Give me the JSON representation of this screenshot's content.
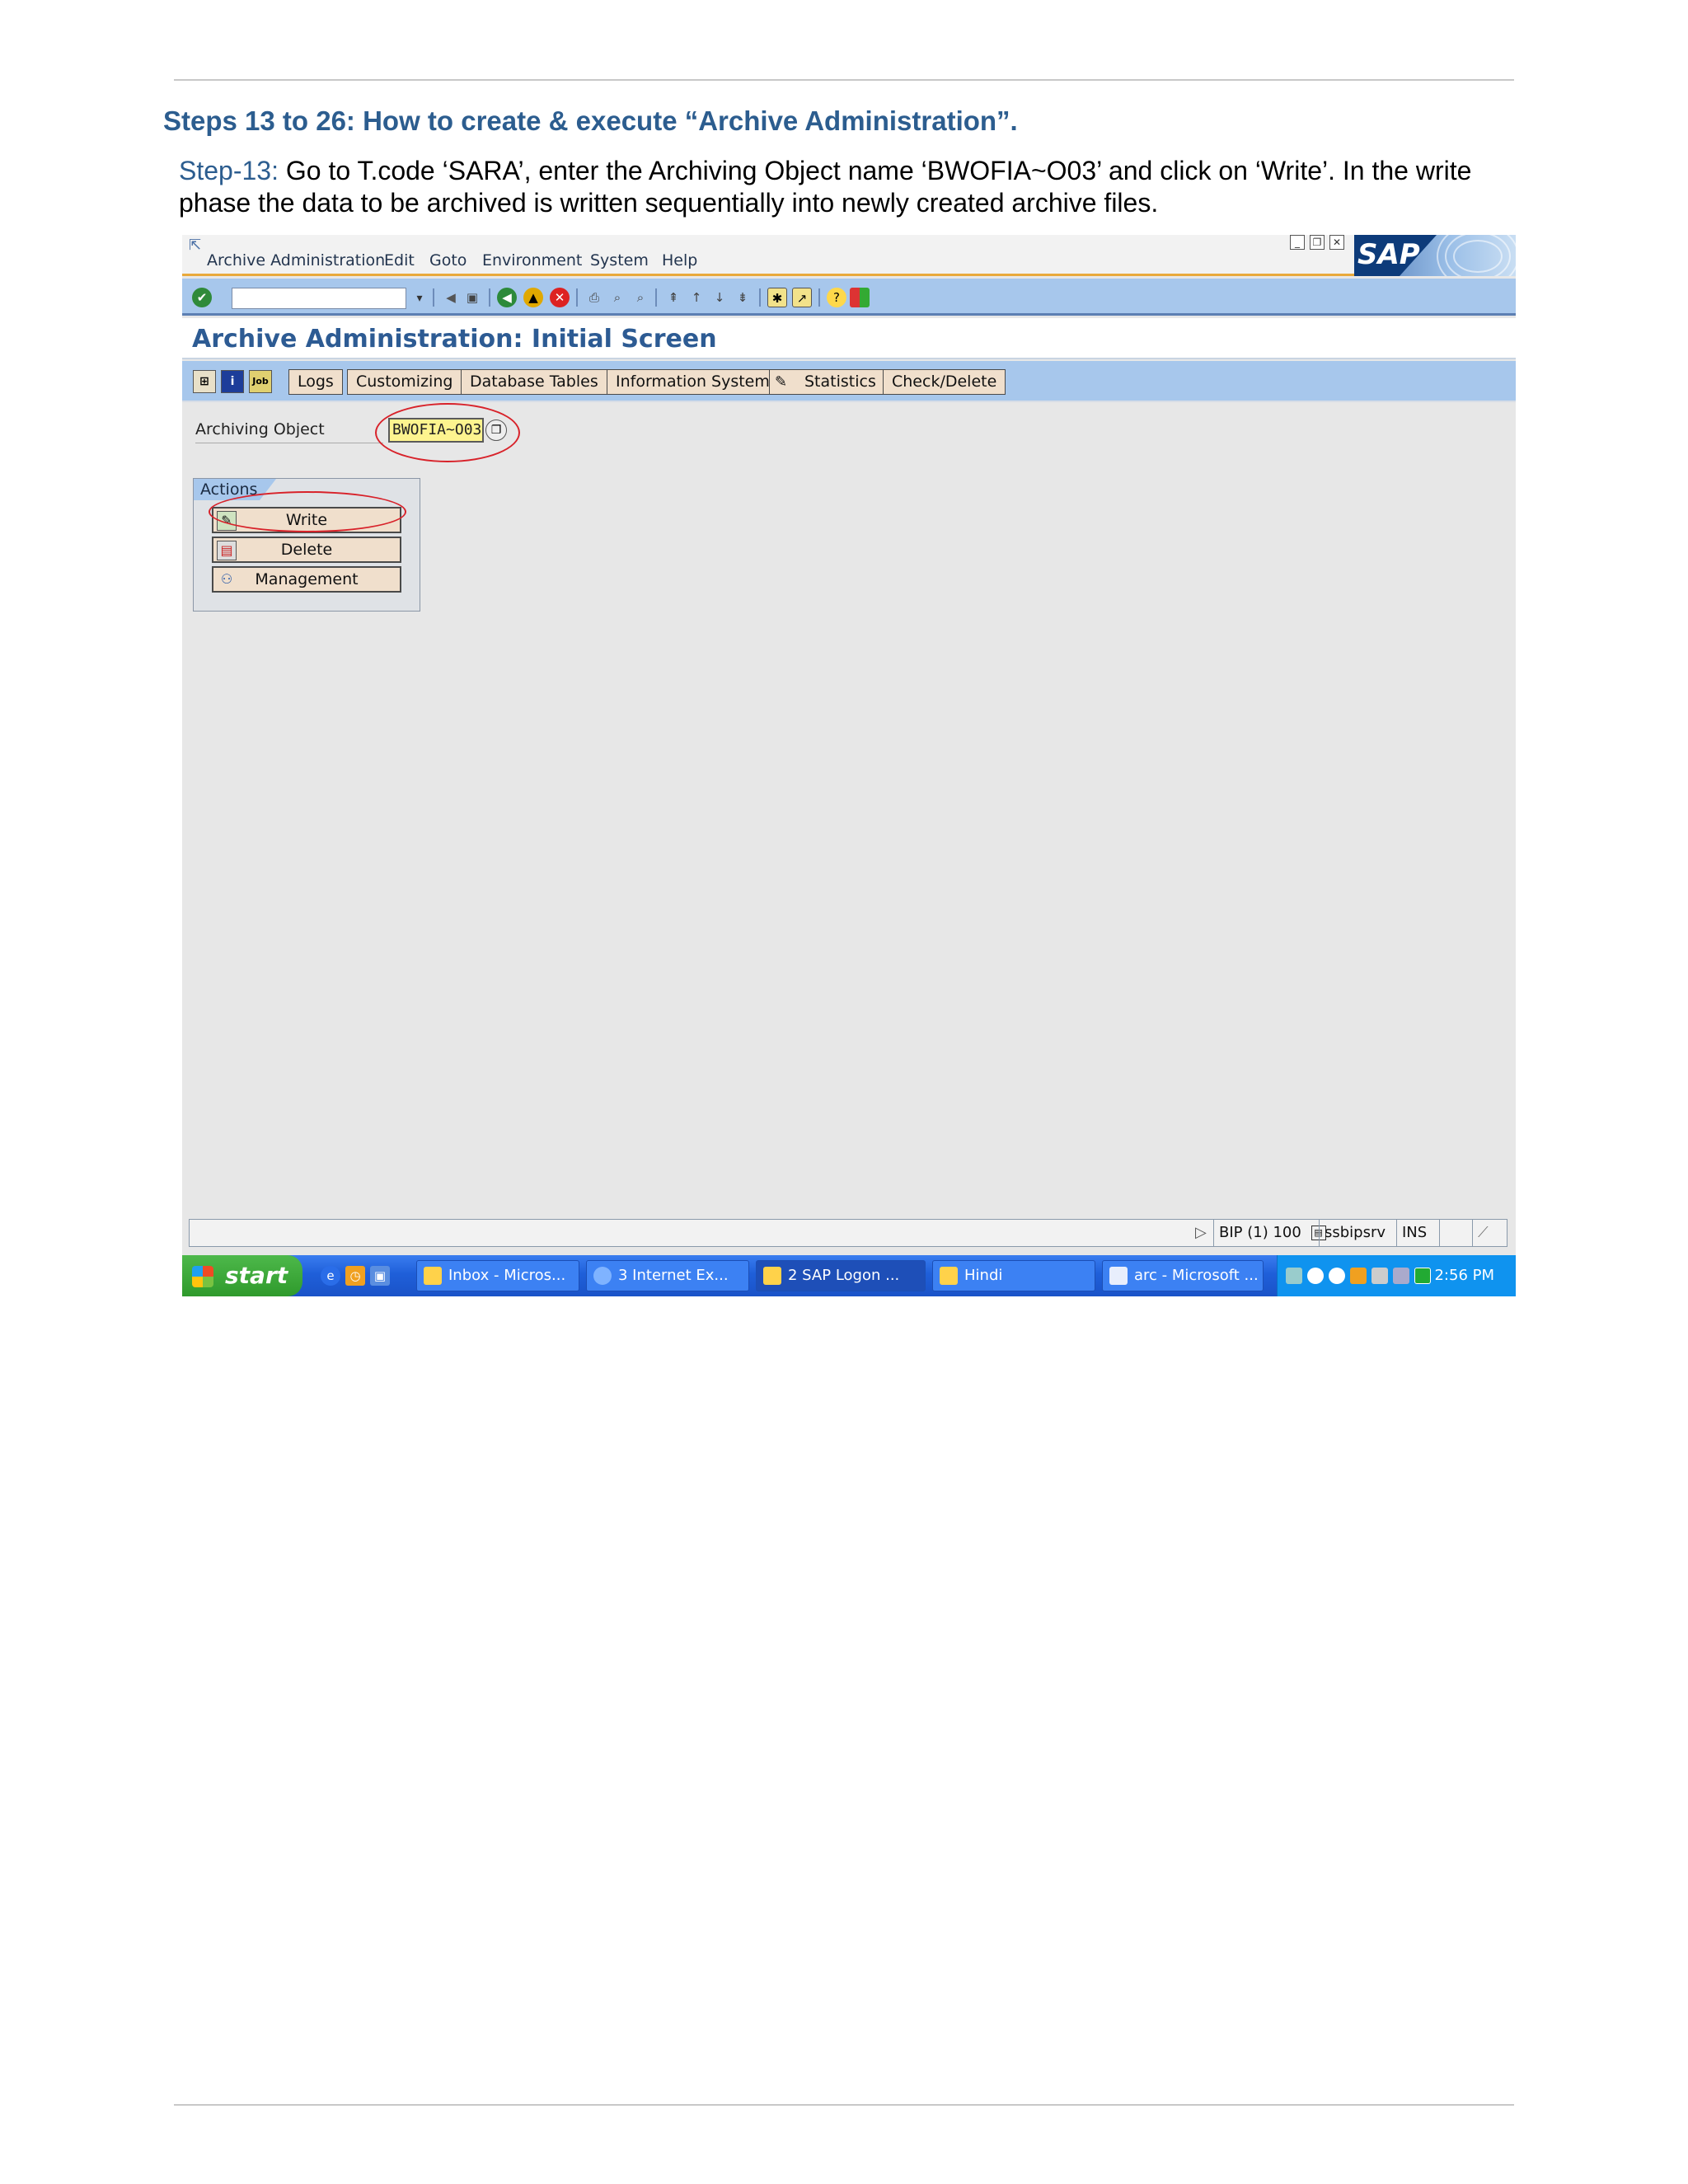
{
  "doc": {
    "heading": "Steps 13 to 26: How to create & execute “Archive Administration”.",
    "step_label": "Step-13:",
    "step_text": " Go to T.code ‘SARA’, enter the Archiving Object name ‘BWOFIA~O03’ and click on ‘Write’. In the write phase the data to be archived is written sequentially into newly created archive files."
  },
  "sap": {
    "menu": [
      "Archive Administration",
      "Edit",
      "Goto",
      "Environment",
      "System",
      "Help"
    ],
    "logo_text": "SAP",
    "screen_title": "Archive Administration: Initial Screen",
    "app_buttons": [
      "Logs",
      "Customizing",
      "Database Tables",
      "Information System",
      "Statistics",
      "Check/Delete"
    ],
    "archiving_object_label": "Archiving Object",
    "archiving_object_value": "BWOFIA~O03",
    "actions_title": "Actions",
    "actions": [
      "Write",
      "Delete",
      "Management"
    ],
    "status": {
      "system": "BIP (1) 100",
      "server": "ssbipsrv",
      "mode": "INS"
    }
  },
  "taskbar": {
    "start": "start",
    "tasks": [
      "Inbox - Micros...",
      "3 Internet Ex...",
      "2 SAP Logon ...",
      "Hindi",
      "arc - Microsoft ..."
    ],
    "clock": "2:56 PM"
  }
}
